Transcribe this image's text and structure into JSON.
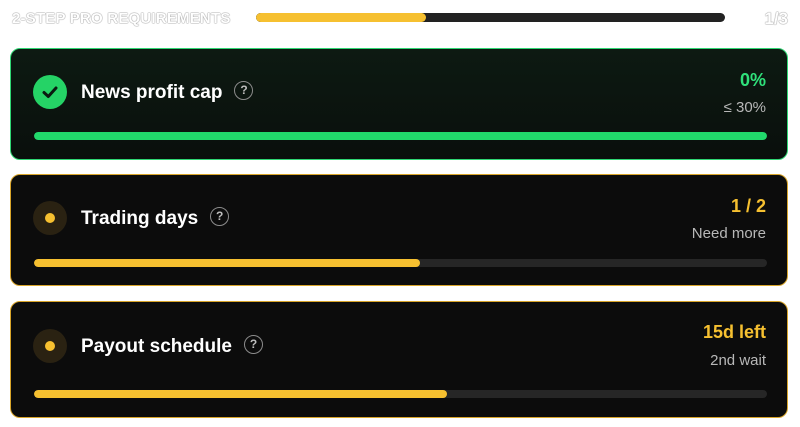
{
  "header": {
    "title": "2-STEP PRO REQUIREMENTS",
    "progress": 0.363,
    "count": "1/3"
  },
  "colors": {
    "success": "#2fe07a",
    "warning": "#f6c030",
    "card_bg": "#0d0d0d"
  },
  "requirements": [
    {
      "title": "News profit cap",
      "status": "complete",
      "status_icon": "check-icon",
      "help_icon": "help-icon",
      "help_glyph": "?",
      "value": "0%",
      "sub": "≤ 30%",
      "progress": 1.0
    },
    {
      "title": "Trading days",
      "status": "in-progress",
      "status_icon": "dot-icon",
      "help_icon": "help-icon",
      "help_glyph": "?",
      "value": "1 / 2",
      "sub": "Need more",
      "progress": 0.527
    },
    {
      "title": "Payout schedule",
      "status": "in-progress",
      "status_icon": "dot-icon",
      "help_icon": "help-icon",
      "help_glyph": "?",
      "value": "15d left",
      "sub": "2nd wait",
      "progress": 0.564
    }
  ]
}
